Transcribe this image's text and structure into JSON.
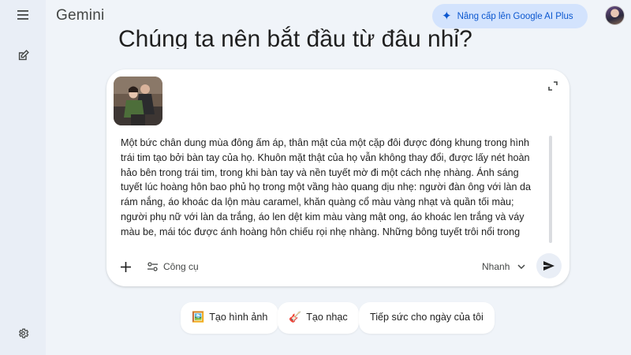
{
  "header": {
    "title": "Gemini",
    "upgrade_label": "Nâng cấp lên Google AI Plus",
    "upgrade_icon": "sparkle-icon"
  },
  "sidebar": {
    "menu_icon": "menu-icon",
    "new_chat_icon": "edit-icon",
    "settings_icon": "gear-icon"
  },
  "greeting": "Chúng ta nên bắt đầu từ đâu nhỉ?",
  "composer": {
    "prompt": "Một bức chân dung mùa đông ấm áp, thân mật của một cặp đôi được đóng khung trong hình trái tim tạo bởi bàn tay của họ. Khuôn mặt thật của họ vẫn không thay đổi, được lấy nét hoàn hảo bên trong trái tim, trong khi bàn tay và nền tuyết mờ đi một cách nhẹ nhàng. Ánh sáng tuyết lúc hoàng hôn bao phủ họ trong một vầng hào quang dịu nhẹ: người đàn ông với làn da rám nắng, áo khoác da lộn màu caramel, khăn quàng cổ màu vàng nhạt và quần tối màu; người phụ nữ với làn da trắng, áo len dệt kim màu vàng mật ong, áo khoác len trắng và váy màu be, mái tóc được ánh hoàng hôn chiếu rọi nhẹ nhàng. Những bông tuyết trôi nổi trong",
    "tools_label": "Công cụ",
    "model_label": "Nhanh",
    "attachment_icon": "photo-thumbnail",
    "add_icon": "plus-icon",
    "tools_icon": "tune-icon",
    "send_icon": "send-icon"
  },
  "chips": [
    {
      "emoji": "🖼️",
      "label": "Tạo hình ảnh"
    },
    {
      "emoji": "🎸",
      "label": "Tạo nhạc"
    },
    {
      "emoji": "",
      "label": "Tiếp sức cho ngày của tôi"
    }
  ],
  "colors": {
    "background": "#f0f4f9",
    "rail": "#e9eef6",
    "accent": "#0b57d0",
    "upgrade_bg": "#d3e3fd"
  }
}
